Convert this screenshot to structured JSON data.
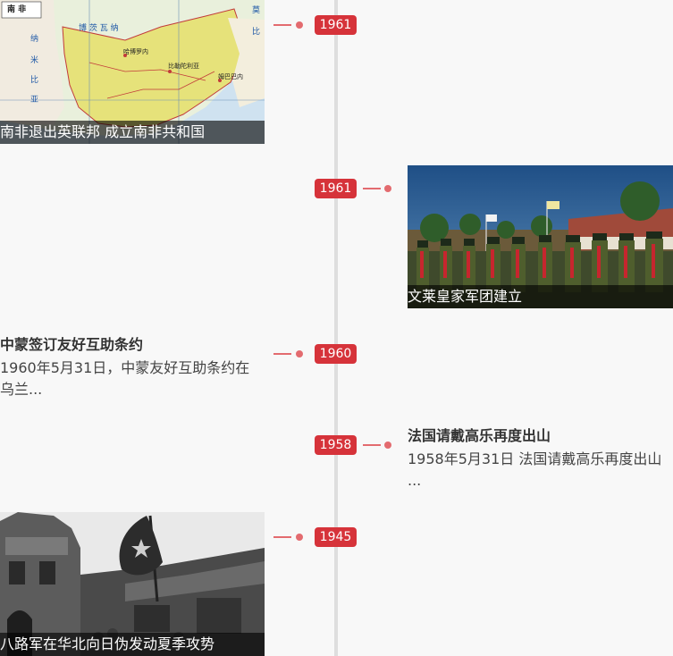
{
  "timeline": {
    "events": [
      {
        "year": "1961",
        "caption": "南非退出英联邦 成立南非共和国",
        "image": "south-africa-map"
      },
      {
        "year": "1961",
        "caption": "文莱皇家军团建立",
        "image": "soldiers-parade"
      },
      {
        "year": "1960",
        "title": "中蒙签订友好互助条约",
        "desc": "1960年5月31日，中蒙友好互助条约在乌兰..."
      },
      {
        "year": "1958",
        "title": "法国请戴高乐再度出山",
        "desc": "1958年5月31日 法国请戴高乐再度出山 ..."
      },
      {
        "year": "1945",
        "caption": "八路军在华北向日伪发动夏季攻势",
        "image": "war-flag-photo"
      }
    ],
    "map_labels": {
      "country_sa": "南  非",
      "botswana": "博 茨 瓦 纳",
      "namibia": "纳",
      "namibia2": "米",
      "namibia3": "比",
      "namibia4": "亚",
      "city1": "比勒陀利亚",
      "city2": "哈博罗内",
      "city3": "姆巴巴内",
      "mozambique": "莫",
      "mozambique2": "比"
    }
  },
  "colors": {
    "accent": "#d6333a",
    "line": "#e36b6f",
    "timeline": "#dedede"
  }
}
